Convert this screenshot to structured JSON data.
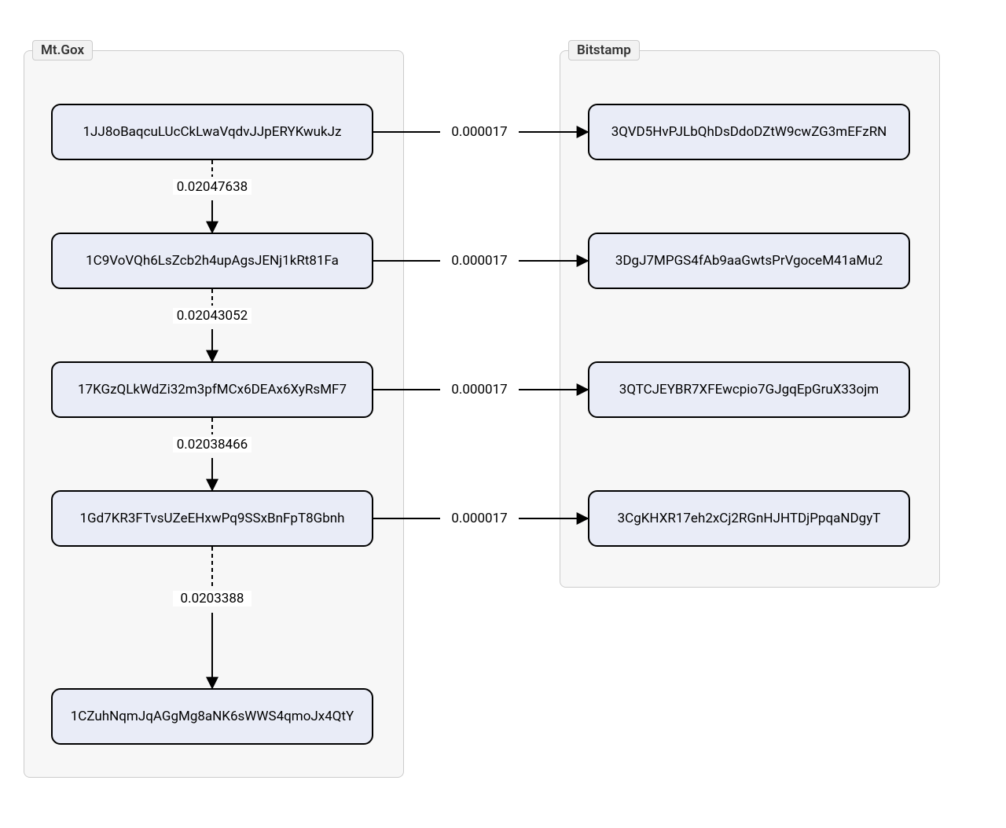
{
  "groups": {
    "left": {
      "label": "Mt.Gox"
    },
    "right": {
      "label": "Bitstamp"
    }
  },
  "nodes": {
    "l1": "1JJ8oBaqcuLUcCkLwaVqdvJJpERYKwukJz",
    "l2": "1C9VoVQh6LsZcb2h4upAgsJENj1kRt81Fa",
    "l3": "17KGzQLkWdZi32m3pfMCx6DEAx6XyRsMF7",
    "l4": "1Gd7KR3FTvsUZeEHxwPq9SSxBnFpT8Gbnh",
    "l5": "1CZuhNqmJqAGgMg8aNK6sWWS4qmoJx4QtY",
    "r1": "3QVD5HvPJLbQhDsDdoDZtW9cwZG3mEFzRN",
    "r2": "3DgJ7MPGS4fAb9aaGwtsPrVgoceM41aMu2",
    "r3": "3QTCJEYBR7XFEwcpio7GJgqEpGruX33ojm",
    "r4": "3CgKHXR17eh2xCj2RGnHJHTDjPpqaNDgyT"
  },
  "edges": {
    "v1": "0.02047638",
    "v2": "0.02043052",
    "v3": "0.02038466",
    "v4": "0.0203388",
    "h1": "0.000017",
    "h2": "0.000017",
    "h3": "0.000017",
    "h4": "0.000017"
  }
}
